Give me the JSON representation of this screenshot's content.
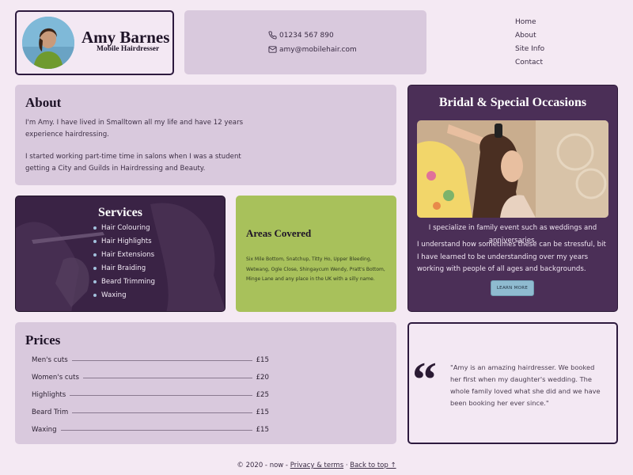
{
  "brand": {
    "name": "Amy Barnes",
    "subtitle": "Mobile Hairdresser"
  },
  "contact": {
    "phone": "01234 567 890",
    "email": "amy@mobilehair.com"
  },
  "nav": {
    "items": [
      "Home",
      "About",
      "Site Info",
      "Contact"
    ]
  },
  "about": {
    "title": "About",
    "paragraphs": [
      "I'm Amy. I have lived in Smalltown all my life and have 12 years experience hairdressing.",
      "I started working part-time time in salons when I was a student getting a City and Guilds in Hairdressing and Beauty."
    ]
  },
  "bridal": {
    "title": "Bridal & Special Occasions",
    "paragraphs": [
      "I specialize in family event such as weddings and anniversaries.",
      "I understand how sometimes these can be stressful, bit I have learned to be understanding over my years working with people of all ages and backgrounds."
    ],
    "button_label": "LEARN MORE"
  },
  "services": {
    "title": "Services",
    "items": [
      "Hair Colouring",
      "Hair Highlights",
      "Hair Extensions",
      "Hair Braiding",
      "Beard Trimming",
      "Waxing"
    ]
  },
  "areas": {
    "title": "Areas Covered",
    "text": "Six Mile Bottom, Snatchup, Titty Ho, Upper Bleeding, Wetwang, Ogle Close, Shingaycum Wendy, Pratt's Bottom, Minge Lane and any place in the UK with a silly name."
  },
  "prices": {
    "title": "Prices",
    "rows": [
      {
        "item": "Men's cuts",
        "price": "£15"
      },
      {
        "item": "Women's cuts",
        "price": "£20"
      },
      {
        "item": "Highlights",
        "price": "£25"
      },
      {
        "item": "Beard Trim",
        "price": "£15"
      },
      {
        "item": "Waxing",
        "price": "£15"
      }
    ]
  },
  "testimonial": {
    "mark": "“",
    "text": "\"Amy is an amazing hairdresser. We booked her first when my daughter's wedding. The whole family loved what she did and we have been booking her ever since.\""
  },
  "footer": {
    "copyright": "© 2020 - now -",
    "privacy_link": "Privacy & terms",
    "separator": "·",
    "top_link": "Back to top ↑"
  },
  "colors": {
    "page_bg": "#f4e9f3",
    "panel_lilac": "#d9c9dd",
    "panel_purple": "#4b2f57",
    "panel_green": "#a8c15b",
    "button": "#8fbbd0"
  }
}
